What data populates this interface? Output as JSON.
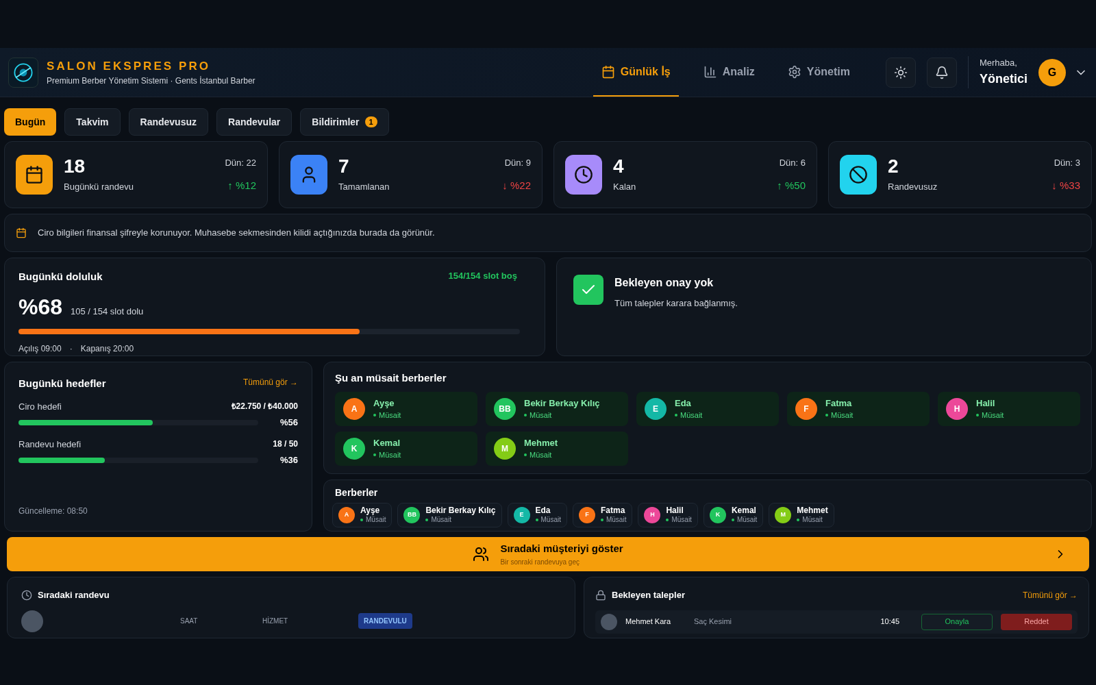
{
  "header": {
    "title": "SALON EKSPRES PRO",
    "subtitle": "Premium Berber Yönetim Sistemi · Gents İstanbul Barber",
    "nav": [
      {
        "label": "Günlük İş",
        "selected": true
      },
      {
        "label": "Analiz",
        "selected": false
      },
      {
        "label": "Yönetim",
        "selected": false
      }
    ],
    "greeting": "Merhaba,",
    "user": "Yönetici",
    "avatar": "G"
  },
  "tabs": [
    {
      "label": "Bugün",
      "selected": true
    },
    {
      "label": "Takvim",
      "selected": false
    },
    {
      "label": "Randevusuz",
      "selected": false
    },
    {
      "label": "Randevular",
      "selected": false
    },
    {
      "label": "Bildirimler",
      "selected": false,
      "badge": "1"
    }
  ],
  "stats": [
    {
      "value": "18",
      "label": "Bugünkü randevu",
      "yesterday": "Dün: 22",
      "change": "↑ %12",
      "kind": "up",
      "color": "#f59e0b"
    },
    {
      "value": "7",
      "label": "Tamamlanan",
      "yesterday": "Dün: 9",
      "change": "↓ %22",
      "kind": "down",
      "color": "#3b82f6"
    },
    {
      "value": "4",
      "label": "Kalan",
      "yesterday": "Dün: 6",
      "change": "↑ %50",
      "kind": "up",
      "color": "#a78bfa"
    },
    {
      "value": "2",
      "label": "Randevusuz",
      "yesterday": "Dün: 3",
      "change": "↓ %33",
      "kind": "down",
      "color": "#22d3ee"
    }
  ],
  "notice": "Ciro bilgileri finansal şifreyle korunuyor. Muhasebe sekmesinden kilidi açtığınızda burada da görünür.",
  "occupancy": {
    "title": "Bugünkü doluluk",
    "free": "154/154 slot boş",
    "percent": "%68",
    "detail": "105 / 154 slot dolu",
    "level": 0.68,
    "opening": "Açılış 09:00",
    "separator": "·",
    "closing": "Kapanış 20:00"
  },
  "approval": {
    "title": "Bekleyen onay yok",
    "text": "Tüm talepler karara bağlanmış.",
    "checked": true
  },
  "goals": {
    "title": "Bugünkü hedefler",
    "link": "Tümünü gör →",
    "items": [
      {
        "label": "Ciro hedefi",
        "value": "₺22.750 / ₺40.000",
        "percent": "%56",
        "level": 0.56
      },
      {
        "label": "Randevu hedefi",
        "value": "18 / 50",
        "percent": "%36",
        "level": 0.36
      }
    ],
    "updated": "Güncelleme: 08:50"
  },
  "available": {
    "title": "Şu an müsait berberler",
    "barbers": [
      {
        "initials": "A",
        "name": "Ayşe",
        "status": "Müsait",
        "color": "#f97316"
      },
      {
        "initials": "BB",
        "name": "Bekir Berkay Kılıç",
        "status": "Müsait",
        "color": "#22c55e"
      },
      {
        "initials": "E",
        "name": "Eda",
        "status": "Müsait",
        "color": "#14b8a6"
      },
      {
        "initials": "F",
        "name": "Fatma",
        "status": "Müsait",
        "color": "#f97316"
      },
      {
        "initials": "H",
        "name": "Halil",
        "status": "Müsait",
        "color": "#ec4899"
      },
      {
        "initials": "K",
        "name": "Kemal",
        "status": "Müsait",
        "color": "#22c55e"
      },
      {
        "initials": "M",
        "name": "Mehmet",
        "status": "Müsait",
        "color": "#84cc16"
      }
    ]
  },
  "barbers": {
    "title": "Berberler",
    "list": [
      {
        "initials": "A",
        "name": "Ayşe",
        "status": "Müsait",
        "color": "#f97316"
      },
      {
        "initials": "BB",
        "name": "Bekir Berkay Kılıç",
        "status": "Müsait",
        "color": "#22c55e"
      },
      {
        "initials": "E",
        "name": "Eda",
        "status": "Müsait",
        "color": "#14b8a6"
      },
      {
        "initials": "F",
        "name": "Fatma",
        "status": "Müsait",
        "color": "#f97316"
      },
      {
        "initials": "H",
        "name": "Halil",
        "status": "Müsait",
        "color": "#ec4899"
      },
      {
        "initials": "K",
        "name": "Kemal",
        "status": "Müsait",
        "color": "#22c55e"
      },
      {
        "initials": "M",
        "name": "Mehmet",
        "status": "Müsait",
        "color": "#84cc16"
      }
    ]
  },
  "next_button": {
    "title": "Sıradaki müşteriyi göster",
    "subtitle": "Bir sonraki randevuya geç"
  },
  "next_appointment": {
    "title": "Sıradaki randevu",
    "columns": [
      "SAAT",
      "HİZMET"
    ],
    "badge": "RANDEVULU"
  },
  "pending": {
    "title": "Bekleyen talepler",
    "link": "Tümünü gör →",
    "rows": [
      {
        "name": "Mehmet Kara",
        "service": "Saç Kesimi",
        "time": "10:45",
        "approve": "Onayla",
        "reject": "Reddet"
      }
    ]
  }
}
